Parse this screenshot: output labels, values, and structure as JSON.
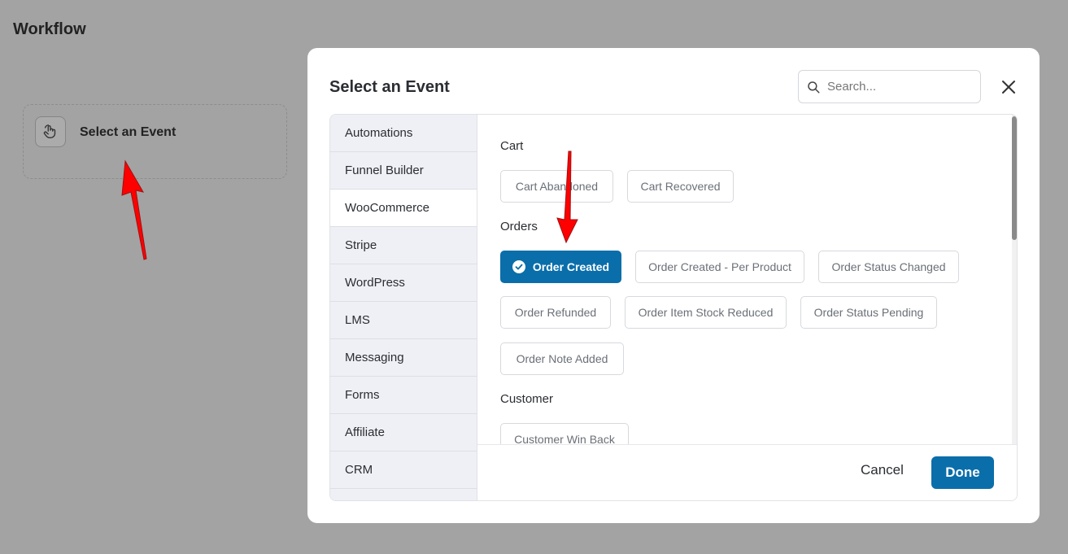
{
  "page": {
    "title": "Workflow",
    "event_card": {
      "label": "Select an Event",
      "icon": "hand-pointer-icon"
    }
  },
  "modal": {
    "title": "Select an Event",
    "search": {
      "placeholder": "Search...",
      "value": ""
    },
    "close_icon": "close-icon",
    "sidebar": {
      "items": [
        {
          "label": "Automations"
        },
        {
          "label": "Funnel Builder"
        },
        {
          "label": "WooCommerce",
          "active": true
        },
        {
          "label": "Stripe"
        },
        {
          "label": "WordPress"
        },
        {
          "label": "LMS"
        },
        {
          "label": "Messaging"
        },
        {
          "label": "Forms"
        },
        {
          "label": "Affiliate"
        },
        {
          "label": "CRM"
        }
      ]
    },
    "groups": {
      "cart": {
        "title": "Cart",
        "events": [
          "Cart Abandoned",
          "Cart Recovered"
        ]
      },
      "orders": {
        "title": "Orders",
        "events": [
          "Order Created",
          "Order Created - Per Product",
          "Order Status Changed",
          "Order Refunded",
          "Order Item Stock Reduced",
          "Order Status Pending",
          "Order Note Added"
        ],
        "selected": "Order Created"
      },
      "customer": {
        "title": "Customer",
        "events": [
          "Customer Win Back"
        ]
      }
    },
    "footer": {
      "cancel_label": "Cancel",
      "done_label": "Done"
    }
  },
  "colors": {
    "backdrop": "#a3a3a3",
    "accent": "#0a6eaa",
    "annotation_arrow": "#ff0000"
  }
}
